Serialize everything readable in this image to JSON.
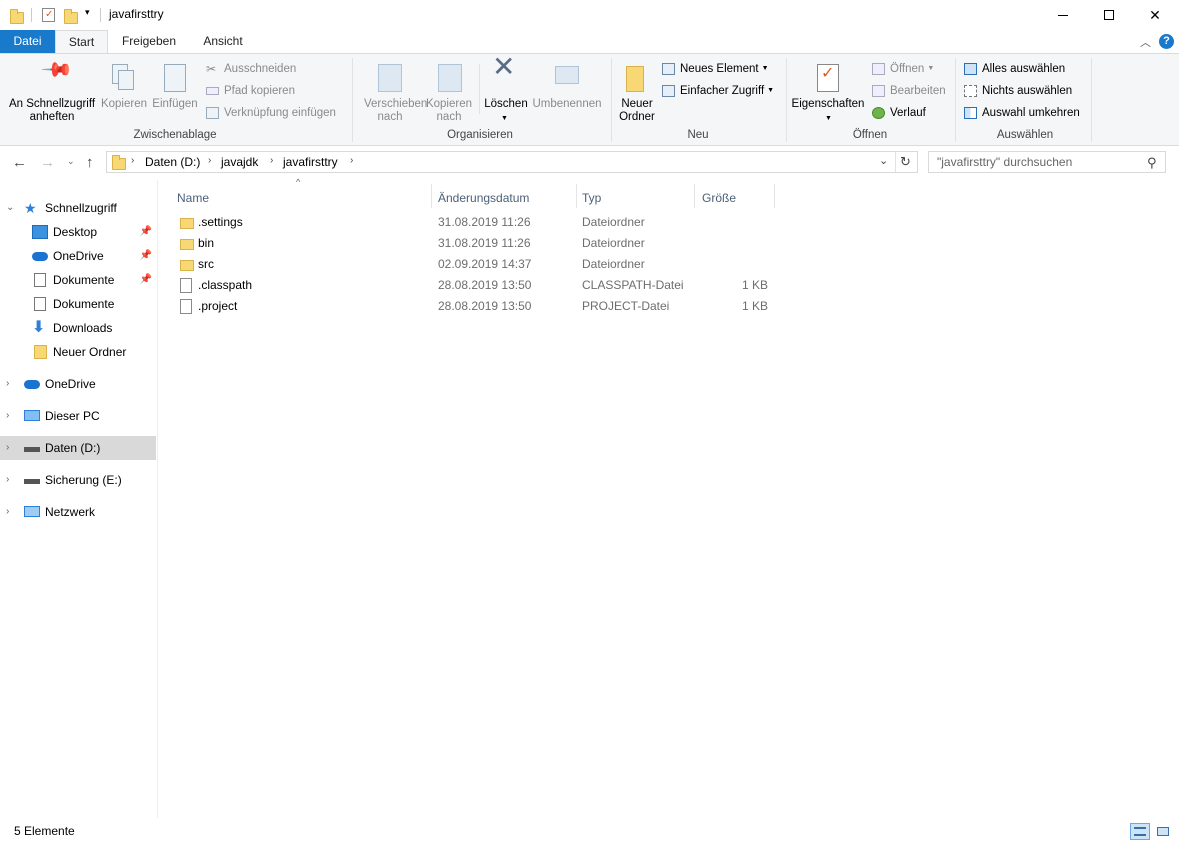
{
  "window": {
    "title": "javafirsttry",
    "controls": {
      "minimize": "—",
      "maximize": "☐",
      "close": "✕"
    }
  },
  "ribbon_tabs": [
    "Datei",
    "Start",
    "Freigeben",
    "Ansicht"
  ],
  "ribbon": {
    "clipboard": {
      "group_label": "Zwischenablage",
      "pin_label": "An Schnellzugriff anheften",
      "copy_label": "Kopieren",
      "paste_label": "Einfügen",
      "cut_label": "Ausschneiden",
      "copy_path_label": "Pfad kopieren",
      "paste_shortcut_label": "Verknüpfung einfügen"
    },
    "organize": {
      "group_label": "Organisieren",
      "move_label": "Verschieben nach",
      "copy_to_label": "Kopieren nach",
      "delete_label": "Löschen",
      "rename_label": "Umbenennen"
    },
    "new": {
      "group_label": "Neu",
      "new_folder_label": "Neuer Ordner",
      "new_item_label": "Neues Element",
      "easy_access_label": "Einfacher Zugriff"
    },
    "open": {
      "group_label": "Öffnen",
      "properties_label": "Eigenschaften",
      "open_label": "Öffnen",
      "edit_label": "Bearbeiten",
      "history_label": "Verlauf"
    },
    "select": {
      "group_label": "Auswählen",
      "select_all_label": "Alles auswählen",
      "select_none_label": "Nichts auswählen",
      "invert_label": "Auswahl umkehren"
    }
  },
  "address": {
    "crumbs": [
      "Daten (D:)",
      "javajdk",
      "javafirsttry"
    ],
    "search_placeholder": "\"javafirsttry\" durchsuchen"
  },
  "nav": {
    "quick_access": "Schnellzugriff",
    "quick_items": [
      {
        "label": "Desktop",
        "pinned": true
      },
      {
        "label": "OneDrive",
        "pinned": true
      },
      {
        "label": "Dokumente",
        "pinned": true
      },
      {
        "label": "Dokumente",
        "pinned": false
      },
      {
        "label": "Downloads",
        "pinned": false
      },
      {
        "label": "Neuer Ordner",
        "pinned": false
      }
    ],
    "roots": [
      "OneDrive",
      "Dieser PC",
      "Daten (D:)",
      "Sicherung (E:)",
      "Netzwerk"
    ],
    "selected_root": "Daten (D:)"
  },
  "columns": [
    "Name",
    "Änderungsdatum",
    "Typ",
    "Größe"
  ],
  "files": [
    {
      "name": ".settings",
      "date": "31.08.2019 11:26",
      "type": "Dateiordner",
      "size": "",
      "kind": "folder"
    },
    {
      "name": "bin",
      "date": "31.08.2019 11:26",
      "type": "Dateiordner",
      "size": "",
      "kind": "folder"
    },
    {
      "name": "src",
      "date": "02.09.2019 14:37",
      "type": "Dateiordner",
      "size": "",
      "kind": "folder"
    },
    {
      "name": ".classpath",
      "date": "28.08.2019 13:50",
      "type": "CLASSPATH-Datei",
      "size": "1 KB",
      "kind": "file"
    },
    {
      "name": ".project",
      "date": "28.08.2019 13:50",
      "type": "PROJECT-Datei",
      "size": "1 KB",
      "kind": "file"
    }
  ],
  "status": {
    "item_count": "5 Elemente"
  },
  "colors": {
    "accent": "#1979ca",
    "folder": "#f8d775",
    "selection": "#d9d9d9"
  }
}
